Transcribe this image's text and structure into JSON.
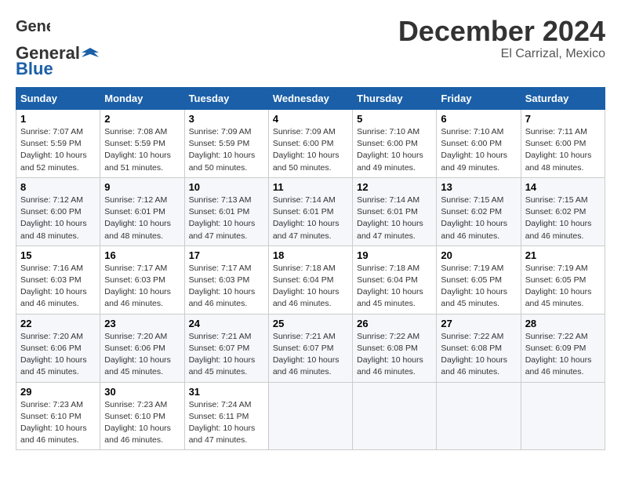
{
  "logo": {
    "line1": "General",
    "line2": "Blue"
  },
  "title": "December 2024",
  "subtitle": "El Carrizal, Mexico",
  "days_header": [
    "Sunday",
    "Monday",
    "Tuesday",
    "Wednesday",
    "Thursday",
    "Friday",
    "Saturday"
  ],
  "weeks": [
    [
      {
        "day": "1",
        "sunrise": "7:07 AM",
        "sunset": "5:59 PM",
        "daylight": "10 hours and 52 minutes."
      },
      {
        "day": "2",
        "sunrise": "7:08 AM",
        "sunset": "5:59 PM",
        "daylight": "10 hours and 51 minutes."
      },
      {
        "day": "3",
        "sunrise": "7:09 AM",
        "sunset": "5:59 PM",
        "daylight": "10 hours and 50 minutes."
      },
      {
        "day": "4",
        "sunrise": "7:09 AM",
        "sunset": "6:00 PM",
        "daylight": "10 hours and 50 minutes."
      },
      {
        "day": "5",
        "sunrise": "7:10 AM",
        "sunset": "6:00 PM",
        "daylight": "10 hours and 49 minutes."
      },
      {
        "day": "6",
        "sunrise": "7:10 AM",
        "sunset": "6:00 PM",
        "daylight": "10 hours and 49 minutes."
      },
      {
        "day": "7",
        "sunrise": "7:11 AM",
        "sunset": "6:00 PM",
        "daylight": "10 hours and 48 minutes."
      }
    ],
    [
      {
        "day": "8",
        "sunrise": "7:12 AM",
        "sunset": "6:00 PM",
        "daylight": "10 hours and 48 minutes."
      },
      {
        "day": "9",
        "sunrise": "7:12 AM",
        "sunset": "6:01 PM",
        "daylight": "10 hours and 48 minutes."
      },
      {
        "day": "10",
        "sunrise": "7:13 AM",
        "sunset": "6:01 PM",
        "daylight": "10 hours and 47 minutes."
      },
      {
        "day": "11",
        "sunrise": "7:14 AM",
        "sunset": "6:01 PM",
        "daylight": "10 hours and 47 minutes."
      },
      {
        "day": "12",
        "sunrise": "7:14 AM",
        "sunset": "6:01 PM",
        "daylight": "10 hours and 47 minutes."
      },
      {
        "day": "13",
        "sunrise": "7:15 AM",
        "sunset": "6:02 PM",
        "daylight": "10 hours and 46 minutes."
      },
      {
        "day": "14",
        "sunrise": "7:15 AM",
        "sunset": "6:02 PM",
        "daylight": "10 hours and 46 minutes."
      }
    ],
    [
      {
        "day": "15",
        "sunrise": "7:16 AM",
        "sunset": "6:03 PM",
        "daylight": "10 hours and 46 minutes."
      },
      {
        "day": "16",
        "sunrise": "7:17 AM",
        "sunset": "6:03 PM",
        "daylight": "10 hours and 46 minutes."
      },
      {
        "day": "17",
        "sunrise": "7:17 AM",
        "sunset": "6:03 PM",
        "daylight": "10 hours and 46 minutes."
      },
      {
        "day": "18",
        "sunrise": "7:18 AM",
        "sunset": "6:04 PM",
        "daylight": "10 hours and 46 minutes."
      },
      {
        "day": "19",
        "sunrise": "7:18 AM",
        "sunset": "6:04 PM",
        "daylight": "10 hours and 45 minutes."
      },
      {
        "day": "20",
        "sunrise": "7:19 AM",
        "sunset": "6:05 PM",
        "daylight": "10 hours and 45 minutes."
      },
      {
        "day": "21",
        "sunrise": "7:19 AM",
        "sunset": "6:05 PM",
        "daylight": "10 hours and 45 minutes."
      }
    ],
    [
      {
        "day": "22",
        "sunrise": "7:20 AM",
        "sunset": "6:06 PM",
        "daylight": "10 hours and 45 minutes."
      },
      {
        "day": "23",
        "sunrise": "7:20 AM",
        "sunset": "6:06 PM",
        "daylight": "10 hours and 45 minutes."
      },
      {
        "day": "24",
        "sunrise": "7:21 AM",
        "sunset": "6:07 PM",
        "daylight": "10 hours and 45 minutes."
      },
      {
        "day": "25",
        "sunrise": "7:21 AM",
        "sunset": "6:07 PM",
        "daylight": "10 hours and 46 minutes."
      },
      {
        "day": "26",
        "sunrise": "7:22 AM",
        "sunset": "6:08 PM",
        "daylight": "10 hours and 46 minutes."
      },
      {
        "day": "27",
        "sunrise": "7:22 AM",
        "sunset": "6:08 PM",
        "daylight": "10 hours and 46 minutes."
      },
      {
        "day": "28",
        "sunrise": "7:22 AM",
        "sunset": "6:09 PM",
        "daylight": "10 hours and 46 minutes."
      }
    ],
    [
      {
        "day": "29",
        "sunrise": "7:23 AM",
        "sunset": "6:10 PM",
        "daylight": "10 hours and 46 minutes."
      },
      {
        "day": "30",
        "sunrise": "7:23 AM",
        "sunset": "6:10 PM",
        "daylight": "10 hours and 46 minutes."
      },
      {
        "day": "31",
        "sunrise": "7:24 AM",
        "sunset": "6:11 PM",
        "daylight": "10 hours and 47 minutes."
      },
      null,
      null,
      null,
      null
    ]
  ],
  "labels": {
    "sunrise": "Sunrise:",
    "sunset": "Sunset:",
    "daylight": "Daylight:"
  }
}
